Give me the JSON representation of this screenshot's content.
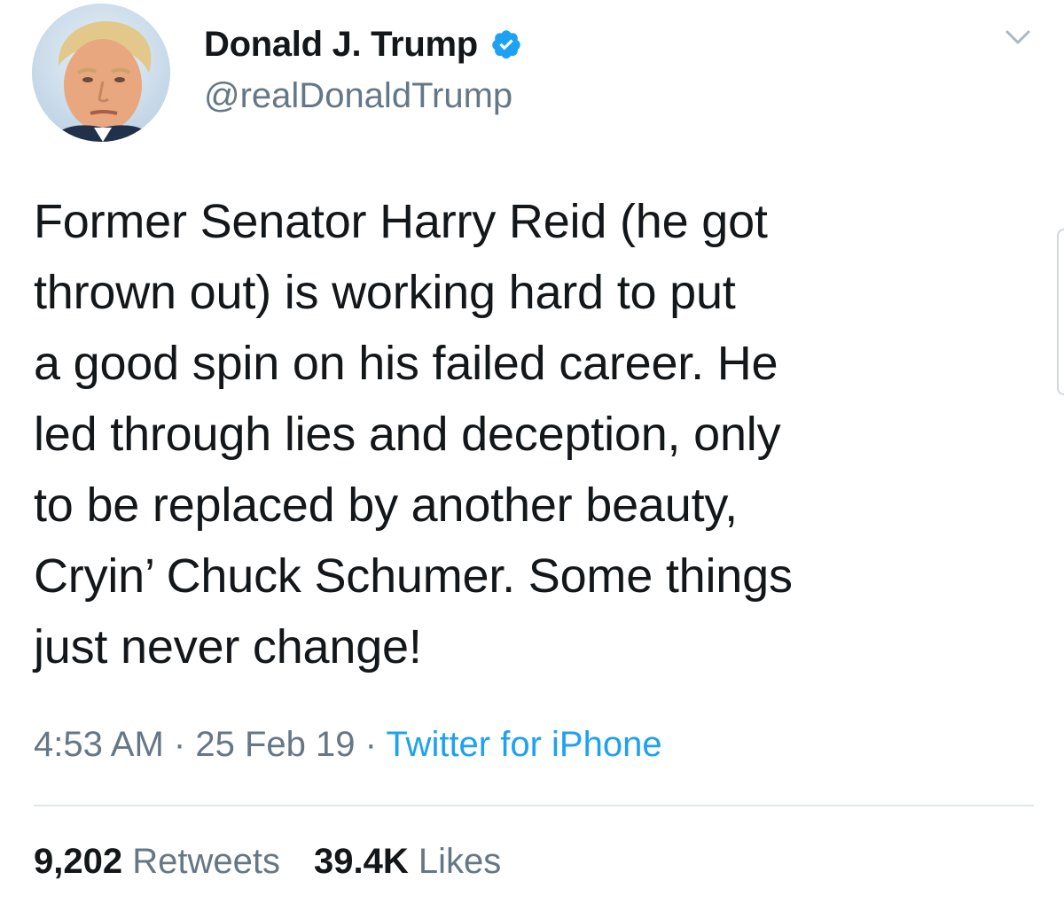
{
  "user": {
    "display_name": "Donald J. Trump",
    "handle": "@realDonaldTrump",
    "verified": true,
    "avatar_icon": "profile-photo"
  },
  "tweet": {
    "text": "Former Senator Harry Reid (he got\nthrown out) is working hard to put\na good spin on his failed career. He\nled through lies and deception, only\nto be replaced by another beauty,\nCryin’ Chuck Schumer. Some things\njust never change!",
    "time": "4:53 AM",
    "date": "25 Feb 19",
    "separator": "·",
    "source": "Twitter for iPhone"
  },
  "stats": {
    "retweets_count": "9,202",
    "retweets_label": "Retweets",
    "likes_count": "39.4K",
    "likes_label": "Likes"
  },
  "icons": {
    "verified": "verified-badge-icon",
    "menu": "chevron-down-icon"
  },
  "colors": {
    "text": "#14171a",
    "secondary": "#657786",
    "accent": "#1da1f2",
    "divider": "#e1e8ed"
  }
}
